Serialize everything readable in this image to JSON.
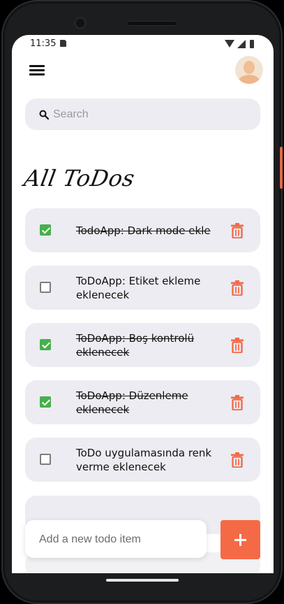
{
  "status_bar": {
    "time": "11:35",
    "icons": [
      "sim-card-icon",
      "wifi-icon",
      "signal-icon",
      "battery-icon"
    ]
  },
  "header": {
    "menu_icon": "hamburger-menu-icon",
    "avatar_icon": "user-avatar-icon"
  },
  "search": {
    "placeholder": "Search",
    "value": ""
  },
  "page_title": "All ToDos",
  "todos": [
    {
      "text": "TodoApp: Dark mode ekle",
      "done": true
    },
    {
      "text": "ToDoApp: Etiket ekleme eklenecek",
      "done": false
    },
    {
      "text": "ToDoApp: Boş kontrolü eklenecek",
      "done": true
    },
    {
      "text": "ToDoApp: Düzenleme eklenecek",
      "done": true
    },
    {
      "text": "ToDo uygulamasında renk verme eklenecek",
      "done": false
    }
  ],
  "add_item": {
    "placeholder": "Add a new todo item",
    "button_icon": "plus-icon"
  },
  "colors": {
    "accent": "#f46a47",
    "check": "#47b04b",
    "card": "#ececf2",
    "delete": "#f46a47"
  }
}
